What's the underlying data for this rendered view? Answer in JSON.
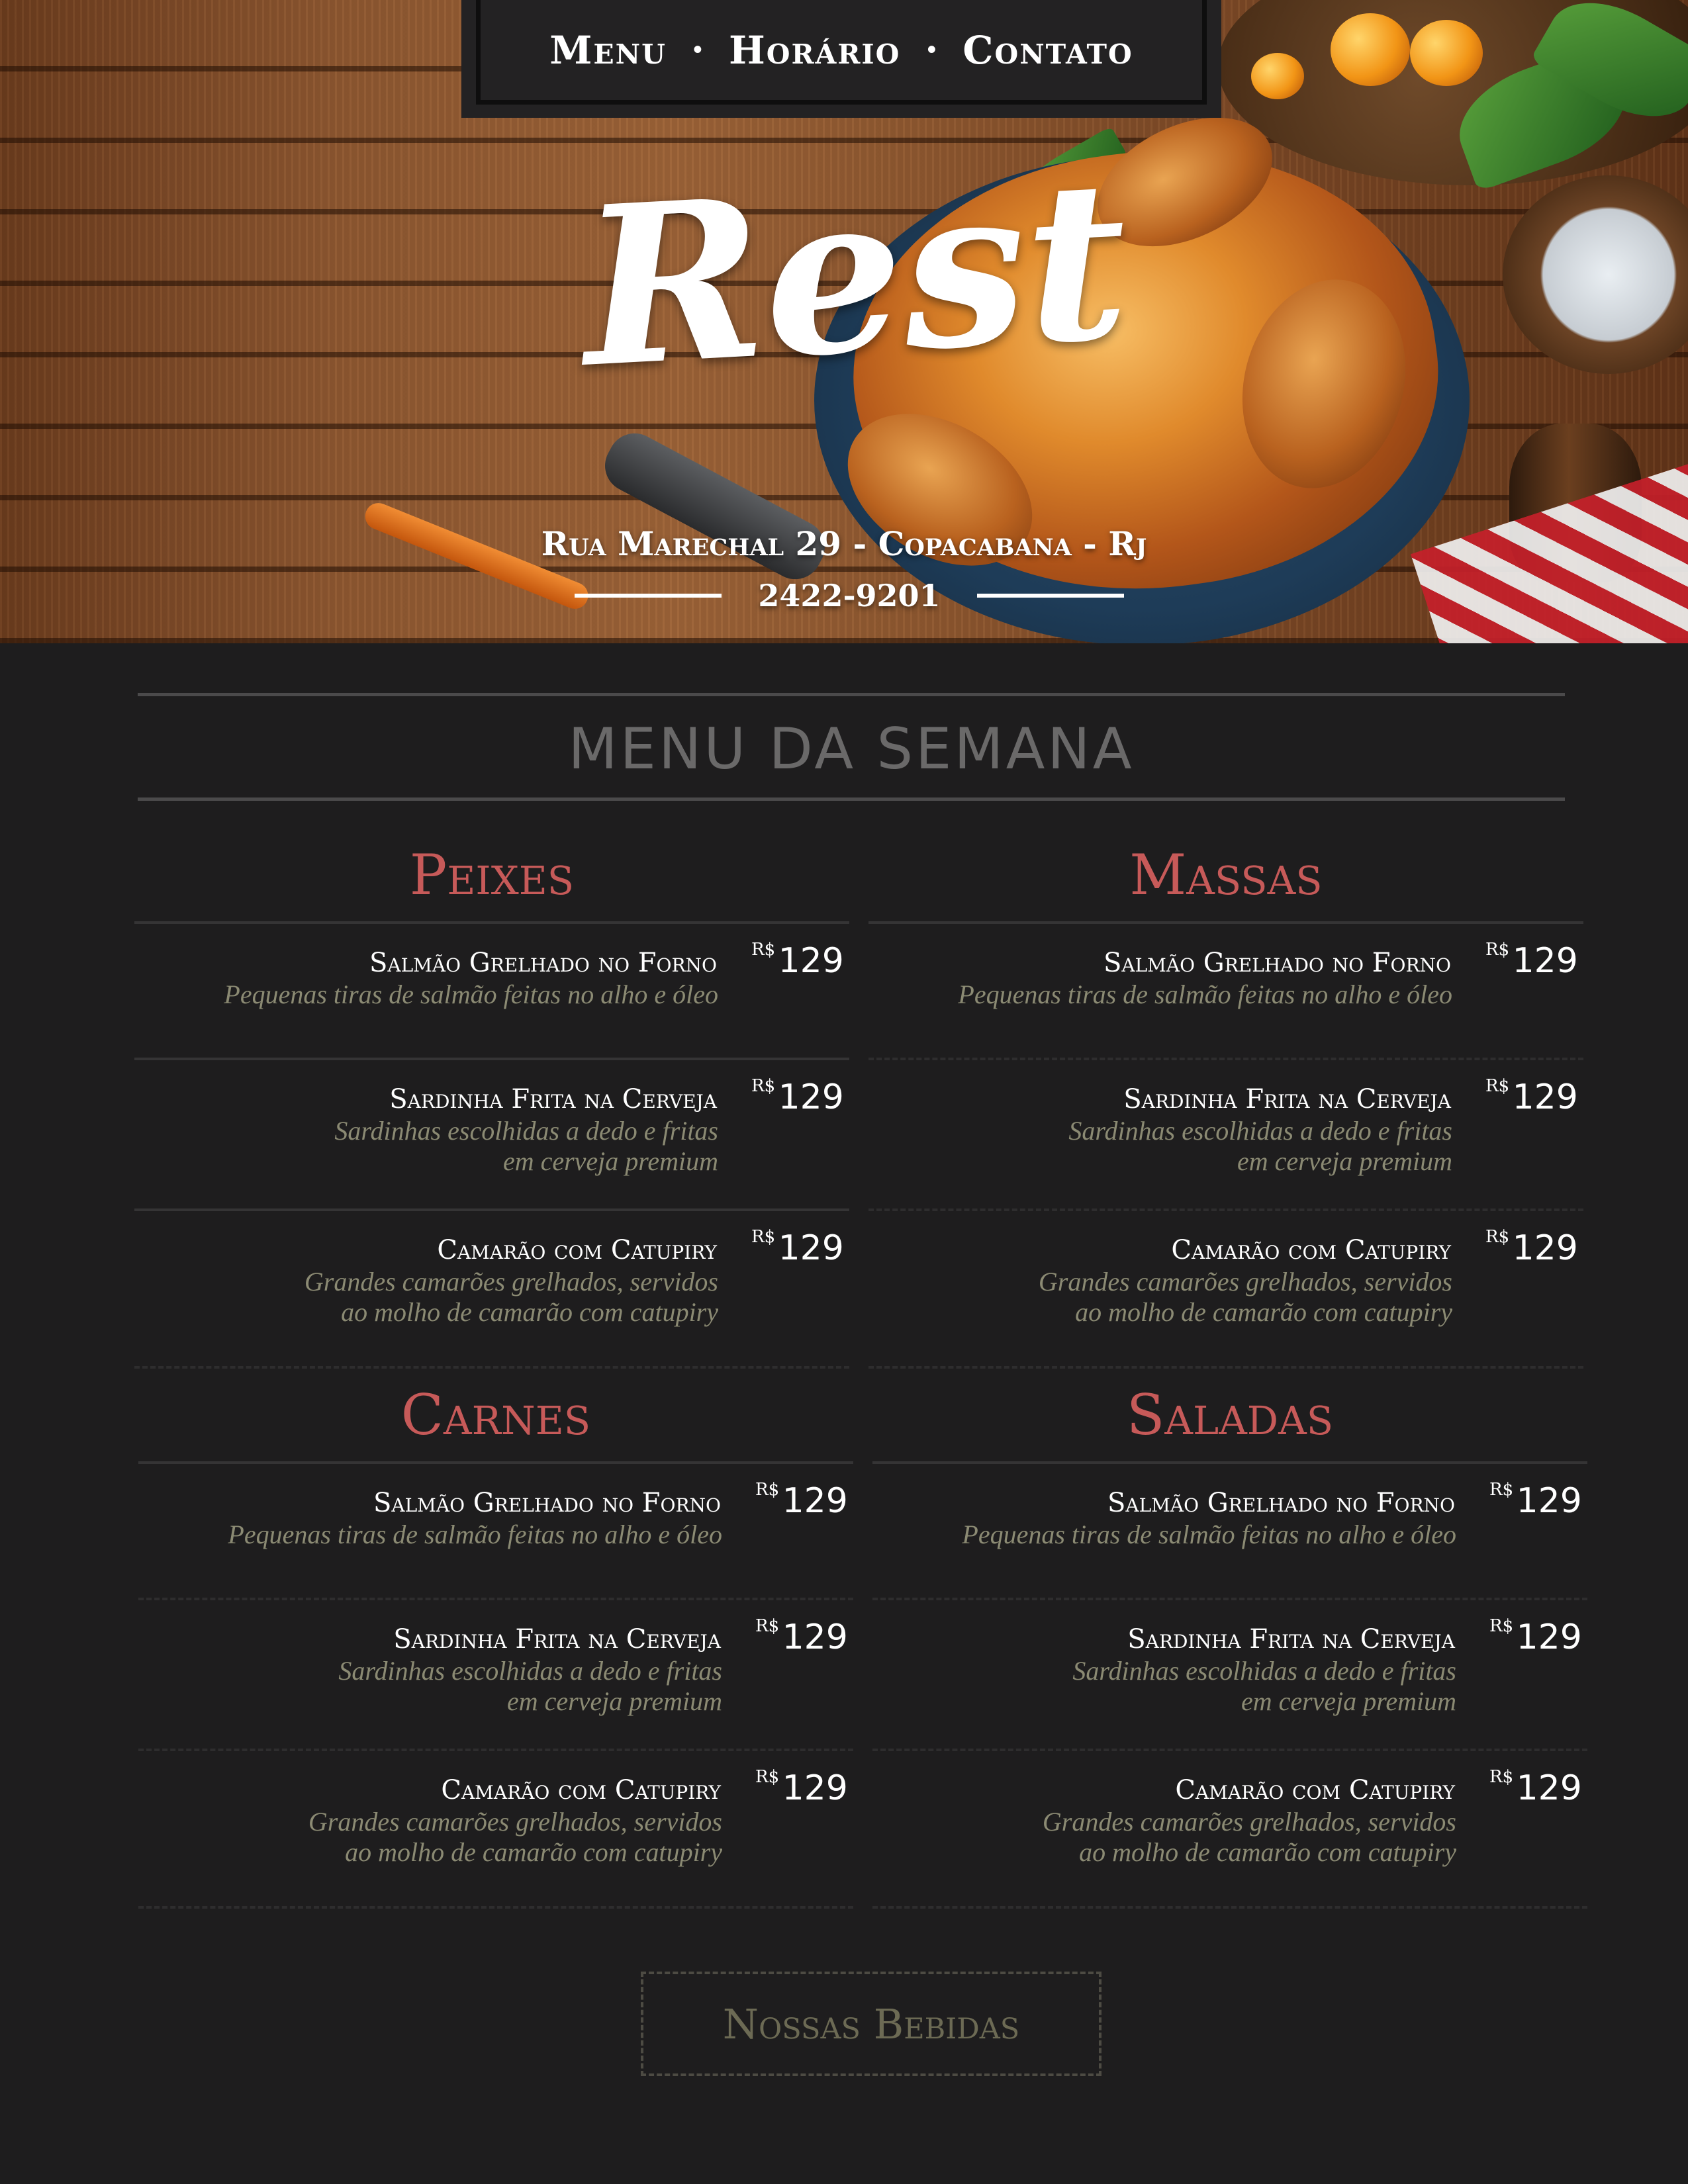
{
  "nav": {
    "items": [
      "Menu",
      "Horário",
      "Contato"
    ],
    "separator": "•"
  },
  "brand": {
    "logo": "Rest",
    "address": "Rua Marechal 29 - Copacabana - Rj",
    "phone": "2422-9201"
  },
  "menu": {
    "title": "MENU DA SEMANA",
    "currency": "R$",
    "sections": [
      {
        "title": "Peixes",
        "dishes": [
          {
            "name": "Salmão Grelhado no Forno",
            "desc": [
              "Pequenas tiras de salmão feitas no alho e óleo"
            ],
            "price": "129"
          },
          {
            "name": "Sardinha Frita na Cerveja",
            "desc": [
              "Sardinhas escolhidas a dedo e fritas",
              "em cerveja premium"
            ],
            "price": "129"
          },
          {
            "name": "Camarão com Catupiry",
            "desc": [
              "Grandes camarões grelhados, servidos",
              "ao molho de camarão com catupiry"
            ],
            "price": "129"
          }
        ]
      },
      {
        "title": "Massas",
        "dishes": [
          {
            "name": "Salmão Grelhado no Forno",
            "desc": [
              "Pequenas tiras de salmão feitas no alho e óleo"
            ],
            "price": "129"
          },
          {
            "name": "Sardinha Frita na Cerveja",
            "desc": [
              "Sardinhas escolhidas a dedo e fritas",
              "em cerveja premium"
            ],
            "price": "129"
          },
          {
            "name": "Camarão com Catupiry",
            "desc": [
              "Grandes camarões grelhados, servidos",
              "ao molho de camarão com catupiry"
            ],
            "price": "129"
          }
        ]
      },
      {
        "title": "Carnes",
        "dishes": [
          {
            "name": "Salmão Grelhado no Forno",
            "desc": [
              "Pequenas tiras de salmão feitas no alho e óleo"
            ],
            "price": "129"
          },
          {
            "name": "Sardinha Frita na Cerveja",
            "desc": [
              "Sardinhas escolhidas a dedo e fritas",
              "em cerveja premium"
            ],
            "price": "129"
          },
          {
            "name": "Camarão com Catupiry",
            "desc": [
              "Grandes camarões grelhados, servidos",
              "ao molho de camarão com catupiry"
            ],
            "price": "129"
          }
        ]
      },
      {
        "title": "Saladas",
        "dishes": [
          {
            "name": "Salmão Grelhado no Forno",
            "desc": [
              "Pequenas tiras de salmão feitas no alho e óleo"
            ],
            "price": "129"
          },
          {
            "name": "Sardinha Frita na Cerveja",
            "desc": [
              "Sardinhas escolhidas a dedo e fritas",
              "em cerveja premium"
            ],
            "price": "129"
          },
          {
            "name": "Camarão com Catupiry",
            "desc": [
              "Grandes camarões grelhados, servidos",
              "ao molho de camarão com catupiry"
            ],
            "price": "129"
          }
        ]
      }
    ]
  },
  "drinks_button": "Nossas Bebidas",
  "colors": {
    "background": "#1e1d1e",
    "section_heading": "#c75a59",
    "dish_description": "#8b8a73",
    "week_title": "#6a6969"
  }
}
